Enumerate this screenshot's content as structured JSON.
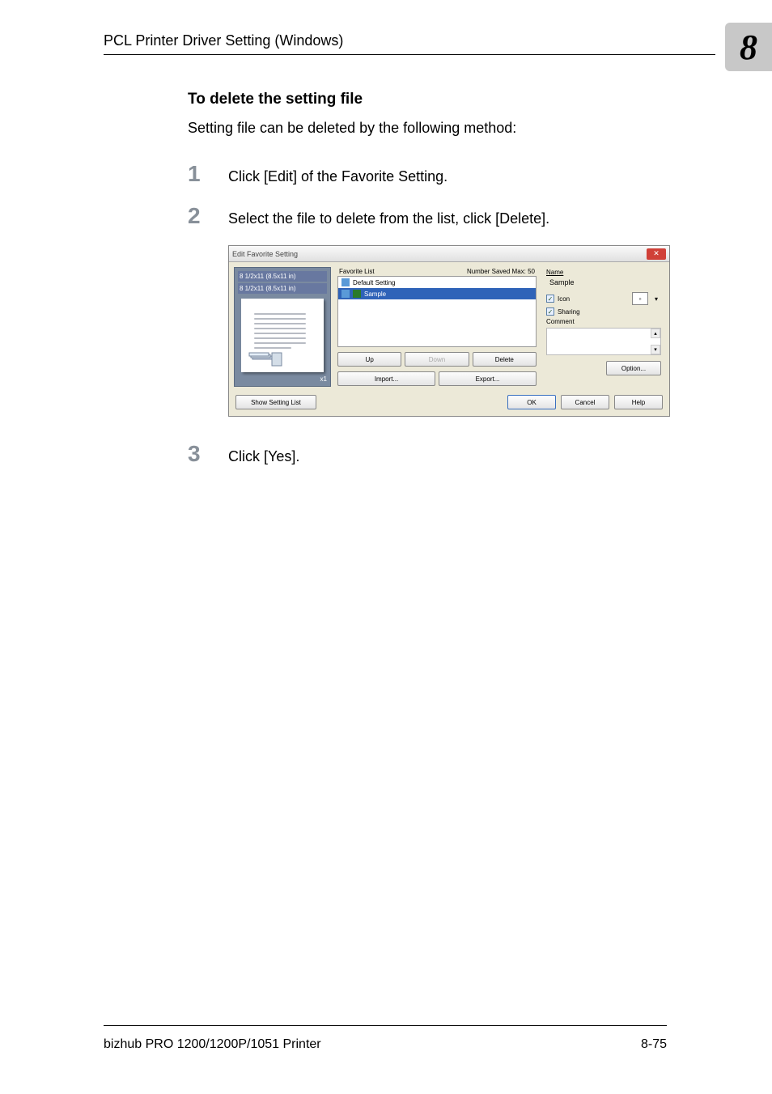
{
  "header": {
    "title": "PCL Printer Driver Setting (Windows)"
  },
  "chapter_tab": "8",
  "section": {
    "title": "To delete the setting file",
    "intro": "Setting file can be deleted by the following method:"
  },
  "steps": {
    "num1": "1",
    "text1": "Click [Edit] of the Favorite Setting.",
    "num2": "2",
    "text2": "Select the file to delete from the list, click [Delete].",
    "num3": "3",
    "text3": "Click [Yes]."
  },
  "dialog": {
    "title": "Edit Favorite Setting",
    "preview_size1": "8 1/2x11 (8.5x11 in)",
    "preview_size2": "8 1/2x11 (8.5x11 in)",
    "preview_x": "x1",
    "favorite_list_label": "Favorite List",
    "number_saved": "Number Saved Max: 50",
    "fav_default": "Default Setting",
    "fav_sample": "Sample",
    "btn_up": "Up",
    "btn_down": "Down",
    "btn_delete": "Delete",
    "btn_import": "Import...",
    "btn_export": "Export...",
    "name_label": "Name",
    "name_value": "Sample",
    "icon_label": "Icon",
    "sharing_label": "Sharing",
    "comment_label": "Comment",
    "btn_option": "Option...",
    "btn_show_list": "Show Setting List",
    "btn_ok": "OK",
    "btn_cancel": "Cancel",
    "btn_help": "Help"
  },
  "footer": {
    "left": "bizhub PRO 1200/1200P/1051 Printer",
    "right": "8-75"
  }
}
